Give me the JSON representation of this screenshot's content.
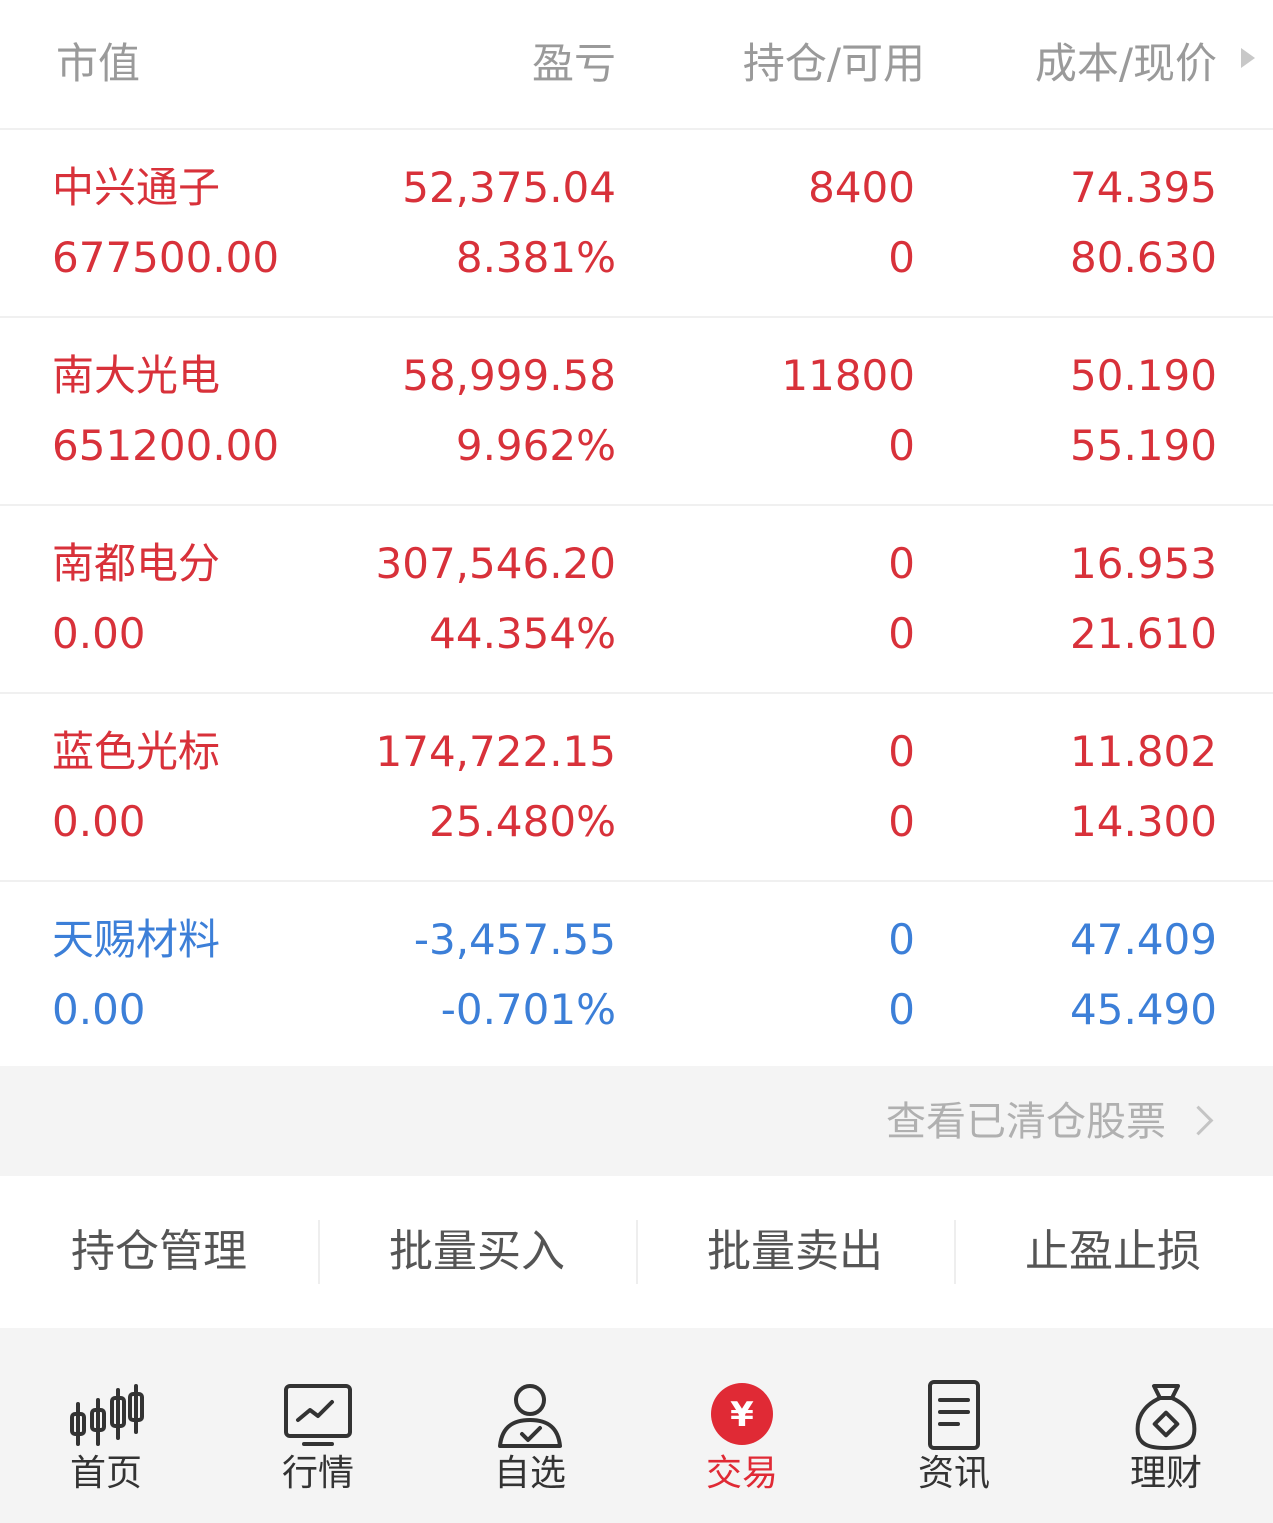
{
  "header": {
    "col_market": "市值",
    "col_pl": "盈亏",
    "col_hold": "持仓/可用",
    "col_cost": "成本/现价"
  },
  "positions": [
    {
      "name": "中兴通子",
      "code": "677500.00",
      "pl": "52,375.04",
      "pl_pct": "8.381%",
      "hold": "8400",
      "avail": "0",
      "cost": "74.395",
      "price": "80.630",
      "status": "red"
    },
    {
      "name": "南大光电",
      "code": "651200.00",
      "pl": "58,999.58",
      "pl_pct": "9.962%",
      "hold": "11800",
      "avail": "0",
      "cost": "50.190",
      "price": "55.190",
      "status": "red"
    },
    {
      "name": "南都电分",
      "code": "0.00",
      "pl": "307,546.20",
      "pl_pct": "44.354%",
      "hold": "0",
      "avail": "0",
      "cost": "16.953",
      "price": "21.610",
      "status": "red"
    },
    {
      "name": "蓝色光标",
      "code": "0.00",
      "pl": "174,722.15",
      "pl_pct": "25.480%",
      "hold": "0",
      "avail": "0",
      "cost": "11.802",
      "price": "14.300",
      "status": "red"
    },
    {
      "name": "天赐材料",
      "code": "0.00",
      "pl": "-3,457.55",
      "pl_pct": "-0.701%",
      "hold": "0",
      "avail": "0",
      "cost": "47.409",
      "price": "45.490",
      "status": "blue"
    }
  ],
  "cleared_link": "查看已清仓股票",
  "actions": {
    "manage": "持仓管理",
    "batch_buy": "批量买入",
    "batch_sell": "批量卖出",
    "stop": "止盈止损"
  },
  "tabbar": {
    "home": "首页",
    "market": "行情",
    "watchlist": "自选",
    "trade": "交易",
    "news": "资讯",
    "finance": "理财",
    "trade_icon_glyph": "¥"
  },
  "colors": {
    "up": "#d8313a",
    "down": "#3c7fd8",
    "active_tab": "#e02a35"
  }
}
